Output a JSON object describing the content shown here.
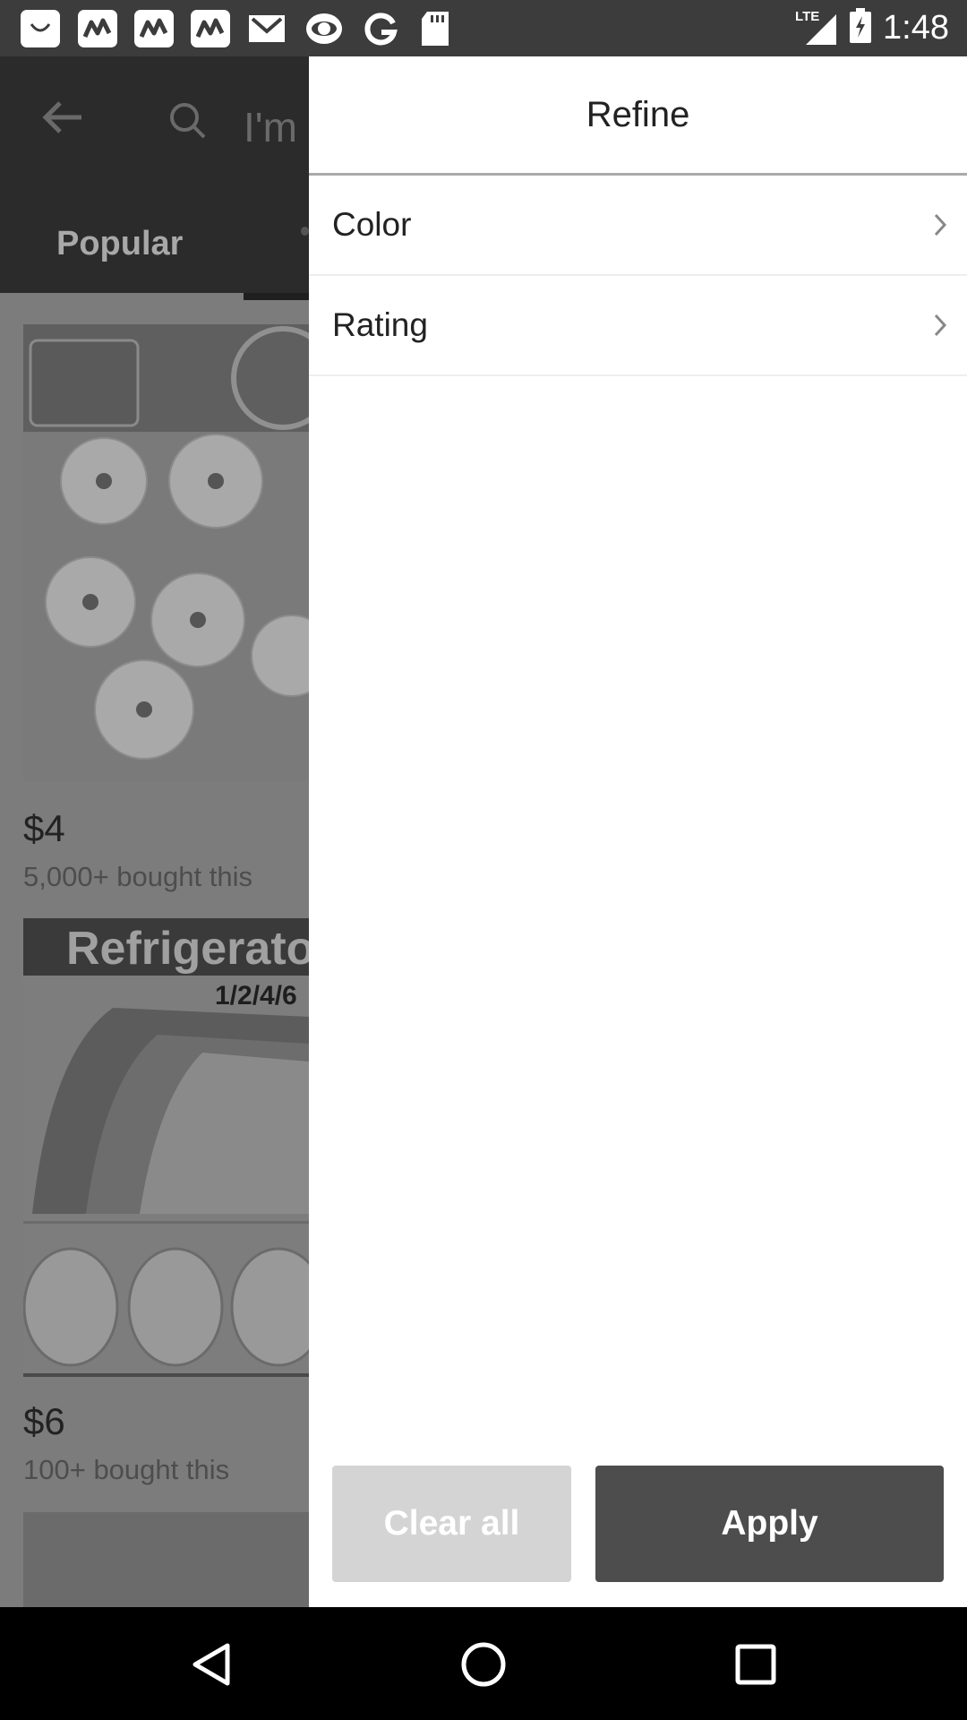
{
  "status_bar": {
    "network": "LTE",
    "time": "1:48",
    "notification_icons": [
      "mercari-smile-icon",
      "wish-app-icon",
      "wish-app-icon",
      "wish-app-icon",
      "gmail-icon",
      "cbs-eye-icon",
      "google-g-icon",
      "sd-card-icon"
    ]
  },
  "background_app": {
    "search_hint": "I'm",
    "tab_label": "Popular",
    "products": [
      {
        "banner": "",
        "price": "$4",
        "bought": "5,000+ bought this"
      },
      {
        "banner": "Refrigerato",
        "sub_banner": "1/2/4/6",
        "price": "$6",
        "bought": "100+ bought this"
      }
    ]
  },
  "drawer": {
    "title": "Refine",
    "filters": [
      {
        "label": "Color"
      },
      {
        "label": "Rating"
      }
    ],
    "clear_label": "Clear all",
    "apply_label": "Apply"
  },
  "colors": {
    "apply_bg": "#4d4d4d",
    "clear_bg": "#d4d4d4",
    "scrim": "#7c7c7c"
  }
}
